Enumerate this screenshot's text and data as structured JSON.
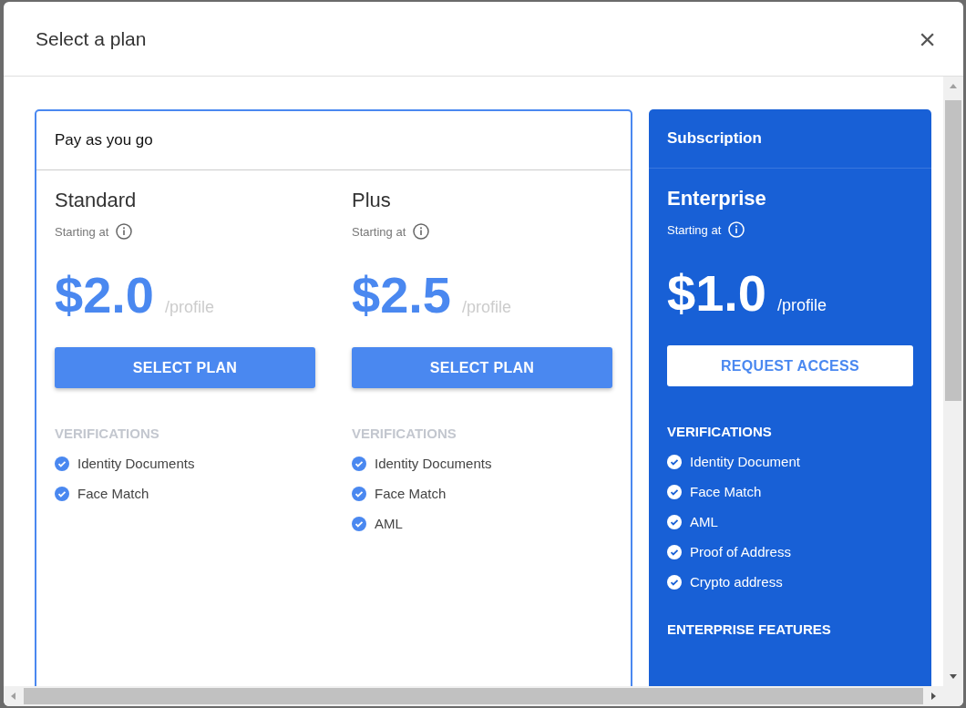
{
  "dialog": {
    "title": "Select a plan",
    "close": "×"
  },
  "groups": [
    {
      "kind": "outlined",
      "title": "Pay as you go",
      "plans": [
        {
          "name": "Standard",
          "starting": "Starting at",
          "price": "$2.0",
          "unit": "/profile",
          "button": "SELECT PLAN",
          "section": "VERIFICATIONS",
          "features": [
            "Identity Documents",
            "Face Match"
          ]
        },
        {
          "name": "Plus",
          "starting": "Starting at",
          "price": "$2.5",
          "unit": "/profile",
          "button": "SELECT PLAN",
          "section": "VERIFICATIONS",
          "features": [
            "Identity Documents",
            "Face Match",
            "AML"
          ]
        }
      ]
    },
    {
      "kind": "filled",
      "title": "Subscription",
      "plans": [
        {
          "name": "Enterprise",
          "starting": "Starting at",
          "price": "$1.0",
          "unit": "/profile",
          "button": "REQUEST ACCESS",
          "section": "VERIFICATIONS",
          "features": [
            "Identity Document",
            "Face Match",
            "AML",
            "Proof of Address",
            "Crypto address"
          ],
          "extra_section": "ENTERPRISE FEATURES"
        }
      ]
    }
  ]
}
